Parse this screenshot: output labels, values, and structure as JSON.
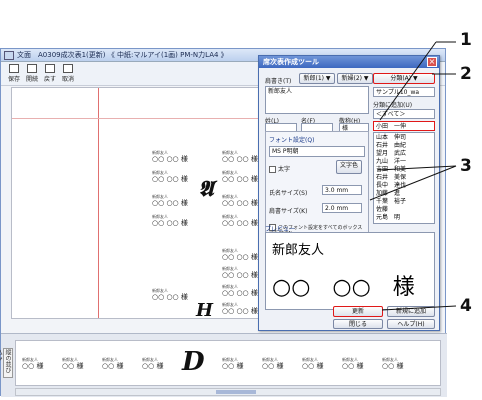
{
  "window": {
    "title": "文面　A0309成次表1(更新) 《 中紙:マルアイ(1画) PM-N力LA4 》",
    "toolbar": [
      {
        "label": "保存",
        "icon": "save-icon"
      },
      {
        "label": "開続",
        "icon": "open-icon"
      },
      {
        "label": "戻す",
        "icon": "undo-icon"
      },
      {
        "label": "取消",
        "icon": "cancel-icon"
      }
    ]
  },
  "canvas": {
    "cards": [
      {
        "top": "新郎友人",
        "name": "○○ ○○ 様"
      }
    ],
    "glyph_top": "𝕬",
    "glyph_mid": "H",
    "glyph_bottom": "D"
  },
  "bottom_strip": {
    "side_label": "縦の並び込み",
    "card_caption": "新郎友人",
    "card_name": "○○ 様"
  },
  "dialog": {
    "title": "席次表作成ツール",
    "label_kakikata": "肩書き(T)",
    "btn_shinro": "新郎(1) ▼",
    "btn_shinpu": "新婦(2) ▼",
    "btn_right": "分類(A) ▼",
    "kakikata_value": "新郎友人",
    "label_sei": "姓(L)",
    "label_mei": "名(F)",
    "label_keisho": "敬称(H)",
    "keisho_value": "様",
    "right_field": "サンプル10_wa",
    "right_caption": "分類に追加(U)",
    "right_select": "＜すべて＞",
    "font_group_title": "フォント設定(Q)",
    "font_value": "MS P明朝",
    "chk_bold": "太字",
    "color_button": "文字色",
    "label_name_size": "氏名サイズ(S)",
    "name_size_value": "3.0 mm",
    "label_kata_size": "肩書サイズ(K)",
    "kata_size_value": "2.0 mm",
    "chk_apply_all": "このフォント設定をすべてのボックスに反映(M)",
    "list_items": [
      "小田　一伸",
      "山本　伸司",
      "石井　由紀",
      "望月　武広",
      "九山　洋一",
      "吉田　和美",
      "石井　美保",
      "長中　達也",
      "加藤　進",
      "千葉　裕子",
      "佐藤　　",
      "元島　明"
    ],
    "preview_label": "プレビュー",
    "preview_title": "新郎友人",
    "preview_name": "○○　○○　様",
    "btn_update": "更新",
    "btn_new": "新規に追加",
    "btn_close": "閉じる",
    "btn_help": "ヘルプ(H)"
  },
  "callouts": [
    "1",
    "2",
    "3",
    "4"
  ]
}
